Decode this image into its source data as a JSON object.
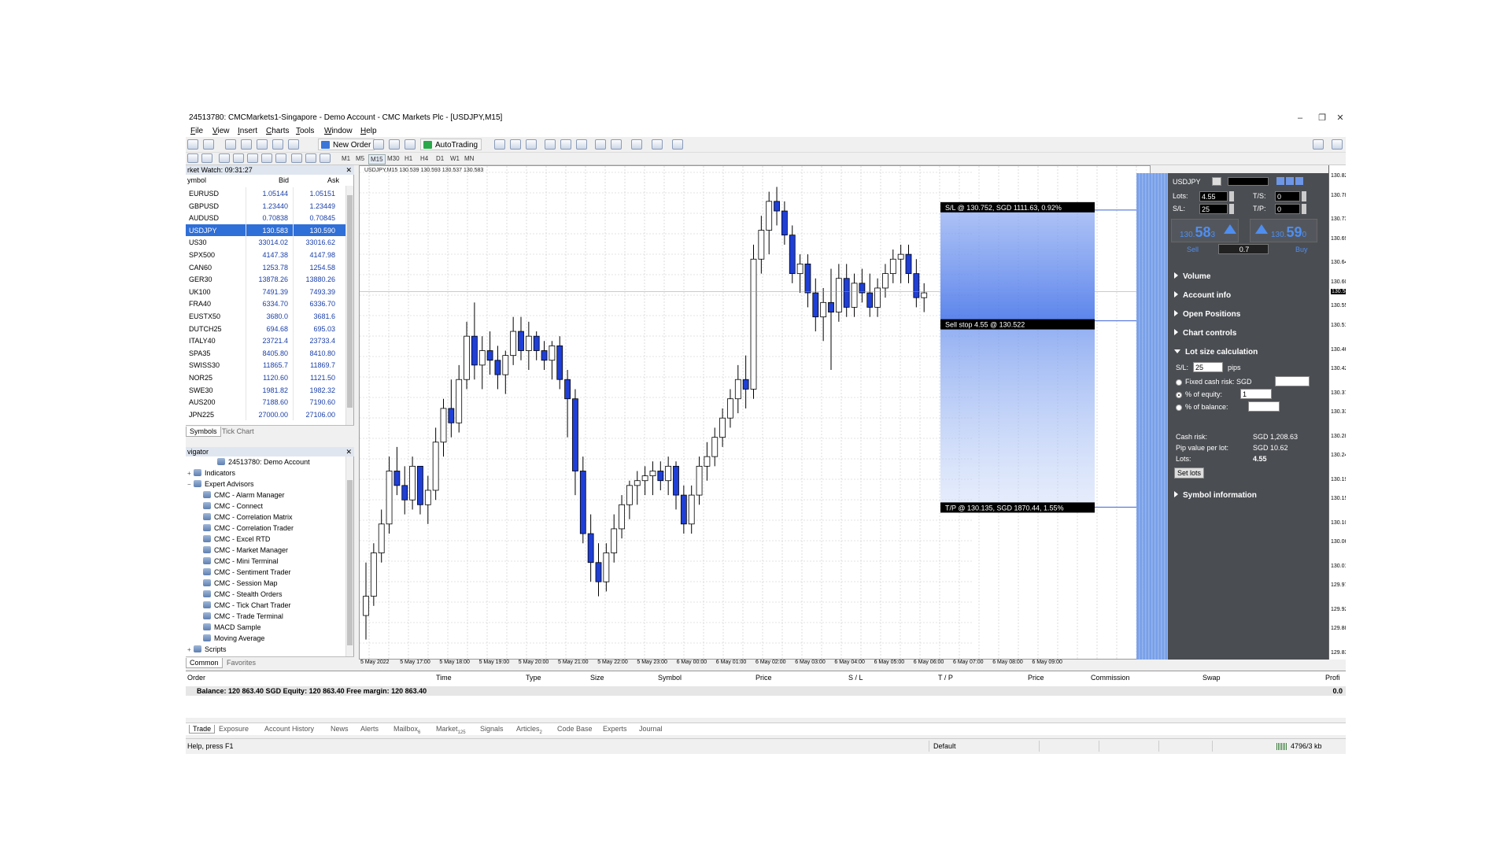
{
  "window": {
    "title": "24513780: CMCMarkets1-Singapore - Demo Account - CMC Markets Plc - [USDJPY,M15]",
    "minimize": "–",
    "maximize": "❐",
    "close": "✕"
  },
  "menu": [
    "File",
    "View",
    "Insert",
    "Charts",
    "Tools",
    "Window",
    "Help"
  ],
  "toolbar": {
    "new_order": "New Order",
    "autotrading": "AutoTrading",
    "timeframes": [
      "M1",
      "M5",
      "M15",
      "M30",
      "H1",
      "H4",
      "D1",
      "W1",
      "MN"
    ],
    "active_timeframe": "M15"
  },
  "market_watch": {
    "header": "rket Watch: 09:31:27",
    "col_symbol": "ymbol",
    "col_bid": "Bid",
    "col_ask": "Ask",
    "rows": [
      {
        "symbol": "EURUSD",
        "bid": "1.05144",
        "ask": "1.05151"
      },
      {
        "symbol": "GBPUSD",
        "bid": "1.23440",
        "ask": "1.23449"
      },
      {
        "symbol": "AUDUSD",
        "bid": "0.70838",
        "ask": "0.70845"
      },
      {
        "symbol": "USDJPY",
        "bid": "130.583",
        "ask": "130.590"
      },
      {
        "symbol": "US30",
        "bid": "33014.02",
        "ask": "33016.62"
      },
      {
        "symbol": "SPX500",
        "bid": "4147.38",
        "ask": "4147.98"
      },
      {
        "symbol": "CAN60",
        "bid": "1253.78",
        "ask": "1254.58"
      },
      {
        "symbol": "GER30",
        "bid": "13878.26",
        "ask": "13880.26"
      },
      {
        "symbol": "UK100",
        "bid": "7491.39",
        "ask": "7493.39"
      },
      {
        "symbol": "FRA40",
        "bid": "6334.70",
        "ask": "6336.70"
      },
      {
        "symbol": "EUSTX50",
        "bid": "3680.0",
        "ask": "3681.6"
      },
      {
        "symbol": "DUTCH25",
        "bid": "694.68",
        "ask": "695.03"
      },
      {
        "symbol": "ITALY40",
        "bid": "23721.4",
        "ask": "23733.4"
      },
      {
        "symbol": "SPA35",
        "bid": "8405.80",
        "ask": "8410.80"
      },
      {
        "symbol": "SWISS30",
        "bid": "11865.7",
        "ask": "11869.7"
      },
      {
        "symbol": "NOR25",
        "bid": "1120.60",
        "ask": "1121.50"
      },
      {
        "symbol": "SWE30",
        "bid": "1981.82",
        "ask": "1982.32"
      },
      {
        "symbol": "AUS200",
        "bid": "7188.60",
        "ask": "7190.60"
      },
      {
        "symbol": "JPN225",
        "bid": "27000.00",
        "ask": "27106.00"
      }
    ],
    "tabs": [
      "Symbols",
      "Tick Chart"
    ]
  },
  "navigator": {
    "header": "vigator",
    "account": "24513780: Demo Account",
    "indicators": "Indicators",
    "expert_advisors": "Expert Advisors",
    "experts": [
      "CMC - Alarm Manager",
      "CMC - Connect",
      "CMC - Correlation Matrix",
      "CMC - Correlation Trader",
      "CMC - Excel RTD",
      "CMC - Market Manager",
      "CMC - Mini Terminal",
      "CMC - Sentiment Trader",
      "CMC - Session Map",
      "CMC - Stealth Orders",
      "CMC - Tick Chart Trader",
      "CMC - Trade Terminal",
      "MACD Sample",
      "Moving Average"
    ],
    "scripts": "Scripts",
    "tabs": [
      "Common",
      "Favorites"
    ]
  },
  "chart": {
    "info": "USDJPY,M15  130.539 130.593 130.537 130.583",
    "sl_label": "S/L @ 130.752, SGD 1111.63, 0.92%",
    "entry_label": "Sell stop 4.55 @ 130.522",
    "tp_label": "T/P @ 130.135, SGD 1870.44, 1.55%",
    "price_labels": [
      "130.82",
      "130.78",
      "130.73",
      "130.69",
      "130.64",
      "130.60",
      "130.58",
      "130.55",
      "130.51",
      "130.46",
      "130.42",
      "130.37",
      "130.33",
      "130.28",
      "130.24",
      "130.19",
      "130.15",
      "130.10",
      "130.06",
      "130.01",
      "129.97",
      "129.92",
      "129.88",
      "129.83"
    ],
    "highlight_price": "130.58",
    "time_labels": [
      "5 May 2022",
      "5 May 17:00",
      "5 May 18:00",
      "5 May 19:00",
      "5 May 20:00",
      "5 May 21:00",
      "5 May 22:00",
      "5 May 23:00",
      "6 May 00:00",
      "6 May 01:00",
      "6 May 02:00",
      "6 May 03:00",
      "6 May 04:00",
      "6 May 05:00",
      "6 May 06:00",
      "6 May 07:00",
      "6 May 08:00",
      "6 May 09:00"
    ],
    "colors": {
      "bull": "#ffffff",
      "bear": "#1f3fd6",
      "zone": "#5b86ec"
    }
  },
  "chart_data": {
    "type": "candlestick",
    "symbol": "USDJPY",
    "timeframe": "M15",
    "ylim": [
      129.83,
      130.84
    ],
    "candles": [
      [
        129.91,
        130.02,
        129.86,
        129.95
      ],
      [
        129.95,
        130.06,
        129.93,
        130.04
      ],
      [
        130.04,
        130.13,
        130.02,
        130.1
      ],
      [
        130.1,
        130.24,
        130.08,
        130.21
      ],
      [
        130.21,
        130.26,
        130.16,
        130.18
      ],
      [
        130.18,
        130.22,
        130.12,
        130.15
      ],
      [
        130.15,
        130.24,
        130.13,
        130.22
      ],
      [
        130.22,
        130.18,
        130.12,
        130.14
      ],
      [
        130.14,
        130.2,
        130.1,
        130.17
      ],
      [
        130.17,
        130.3,
        130.15,
        130.27
      ],
      [
        130.27,
        130.36,
        130.24,
        130.34
      ],
      [
        130.34,
        130.4,
        130.28,
        130.31
      ],
      [
        130.31,
        130.43,
        130.29,
        130.4
      ],
      [
        130.4,
        130.52,
        130.38,
        130.49
      ],
      [
        130.49,
        130.56,
        130.4,
        130.43
      ],
      [
        130.43,
        130.49,
        130.38,
        130.46
      ],
      [
        130.46,
        130.5,
        130.41,
        130.44
      ],
      [
        130.44,
        130.47,
        130.38,
        130.41
      ],
      [
        130.41,
        130.46,
        130.37,
        130.45
      ],
      [
        130.45,
        130.53,
        130.43,
        130.5
      ],
      [
        130.5,
        130.53,
        130.44,
        130.46
      ],
      [
        130.46,
        130.52,
        130.42,
        130.49
      ],
      [
        130.49,
        130.5,
        130.44,
        130.46
      ],
      [
        130.46,
        130.48,
        130.42,
        130.44
      ],
      [
        130.44,
        130.48,
        130.4,
        130.47
      ],
      [
        130.47,
        130.49,
        130.38,
        130.4
      ],
      [
        130.4,
        130.42,
        130.28,
        130.36
      ],
      [
        130.36,
        130.38,
        130.16,
        130.21
      ],
      [
        130.21,
        130.24,
        130.06,
        130.08
      ],
      [
        130.08,
        130.12,
        129.98,
        130.02
      ],
      [
        130.02,
        130.06,
        129.95,
        129.98
      ],
      [
        129.98,
        130.06,
        129.96,
        130.04
      ],
      [
        130.04,
        130.12,
        130.02,
        130.09
      ],
      [
        130.09,
        130.16,
        130.07,
        130.14
      ],
      [
        130.14,
        130.19,
        130.11,
        130.18
      ],
      [
        130.18,
        130.21,
        130.14,
        130.19
      ],
      [
        130.19,
        130.22,
        130.16,
        130.2
      ],
      [
        130.2,
        130.23,
        130.16,
        130.21
      ],
      [
        130.21,
        130.23,
        130.17,
        130.19
      ],
      [
        130.19,
        130.24,
        130.16,
        130.22
      ],
      [
        130.22,
        130.23,
        130.13,
        130.16
      ],
      [
        130.16,
        130.18,
        130.08,
        130.1
      ],
      [
        130.1,
        130.18,
        130.08,
        130.16
      ],
      [
        130.16,
        130.24,
        130.14,
        130.22
      ],
      [
        130.22,
        130.27,
        130.19,
        130.24
      ],
      [
        130.24,
        130.3,
        130.22,
        130.28
      ],
      [
        130.28,
        130.34,
        130.26,
        130.32
      ],
      [
        130.32,
        130.38,
        130.3,
        130.36
      ],
      [
        130.36,
        130.43,
        130.33,
        130.4
      ],
      [
        130.4,
        130.45,
        130.34,
        130.38
      ],
      [
        130.38,
        130.68,
        130.36,
        130.65
      ],
      [
        130.65,
        130.74,
        130.62,
        130.71
      ],
      [
        130.71,
        130.79,
        130.66,
        130.77
      ],
      [
        130.77,
        130.8,
        130.72,
        130.75
      ],
      [
        130.75,
        130.77,
        130.68,
        130.7
      ],
      [
        130.7,
        130.72,
        130.6,
        130.62
      ],
      [
        130.62,
        130.66,
        130.58,
        130.64
      ],
      [
        130.64,
        130.66,
        130.55,
        130.58
      ],
      [
        130.58,
        130.61,
        130.5,
        130.53
      ],
      [
        130.53,
        130.59,
        130.48,
        130.56
      ],
      [
        130.56,
        130.63,
        130.42,
        130.54
      ],
      [
        130.54,
        130.64,
        130.52,
        130.61
      ],
      [
        130.61,
        130.64,
        130.53,
        130.55
      ],
      [
        130.55,
        130.62,
        130.53,
        130.6
      ],
      [
        130.6,
        130.63,
        130.56,
        130.58
      ],
      [
        130.58,
        130.62,
        130.53,
        130.55
      ],
      [
        130.55,
        130.61,
        130.53,
        130.59
      ],
      [
        130.59,
        130.64,
        130.57,
        130.62
      ],
      [
        130.62,
        130.67,
        130.6,
        130.65
      ],
      [
        130.65,
        130.68,
        130.6,
        130.66
      ],
      [
        130.66,
        130.68,
        130.6,
        130.62
      ],
      [
        130.62,
        130.65,
        130.55,
        130.57
      ],
      [
        130.57,
        130.6,
        130.54,
        130.58
      ]
    ],
    "sl_price": 130.752,
    "entry_price": 130.522,
    "tp_price": 130.135
  },
  "side_panel": {
    "symbol": "USDJPY",
    "lots_label": "Lots:",
    "lots_value": "4.55",
    "ts_label": "T/S:",
    "ts_value": "0",
    "sl_label": "S/L:",
    "sl_value": "25",
    "tp_label": "T/P:",
    "tp_value": "0",
    "sell_big": "58",
    "sell_small": "130.",
    "sell_tail": "3",
    "buy_big": "59",
    "buy_small": "130.",
    "buy_tail": "0",
    "sell_label": "Sell",
    "buy_label": "Buy",
    "spread": "0.7",
    "sections": [
      "Volume",
      "Account info",
      "Open Positions",
      "Chart controls"
    ],
    "lot_size_title": "Lot size calculation",
    "sl_pips_label": "S/L:",
    "sl_pips_value": "25",
    "pips": "pips",
    "fixed_cash": "Fixed cash risk: SGD",
    "pct_equity": "% of equity:",
    "pct_equity_value": "1",
    "pct_balance": "% of balance:",
    "cash_risk_label": "Cash risk:",
    "cash_risk_value": "SGD 1,208.63",
    "pip_value_label": "Pip value per lot:",
    "pip_value_value": "SGD 10.62",
    "lots_calc_label": "Lots:",
    "lots_calc_value": "4.55",
    "set_lots": "Set lots",
    "symbol_info": "Symbol information"
  },
  "terminal": {
    "columns": [
      "Order",
      "Time",
      "Type",
      "Size",
      "Symbol",
      "Price",
      "S / L",
      "T / P",
      "Price",
      "Commission",
      "Swap",
      "Profi"
    ],
    "balance": "Balance: 120 863.40 SGD  Equity: 120 863.40  Free margin: 120 863.40",
    "profit_total": "0.0",
    "tabs": [
      "Trade",
      "Exposure",
      "Account History",
      "News",
      "Alerts",
      "Mailbox",
      "Market",
      "Signals",
      "Articles",
      "Code Base",
      "Experts",
      "Journal"
    ],
    "mailbox_badge": "6",
    "market_badge": "125",
    "articles_badge": "2"
  },
  "status": {
    "help": "Help, press F1",
    "profile": "Default",
    "traffic": "4796/3 kb"
  }
}
